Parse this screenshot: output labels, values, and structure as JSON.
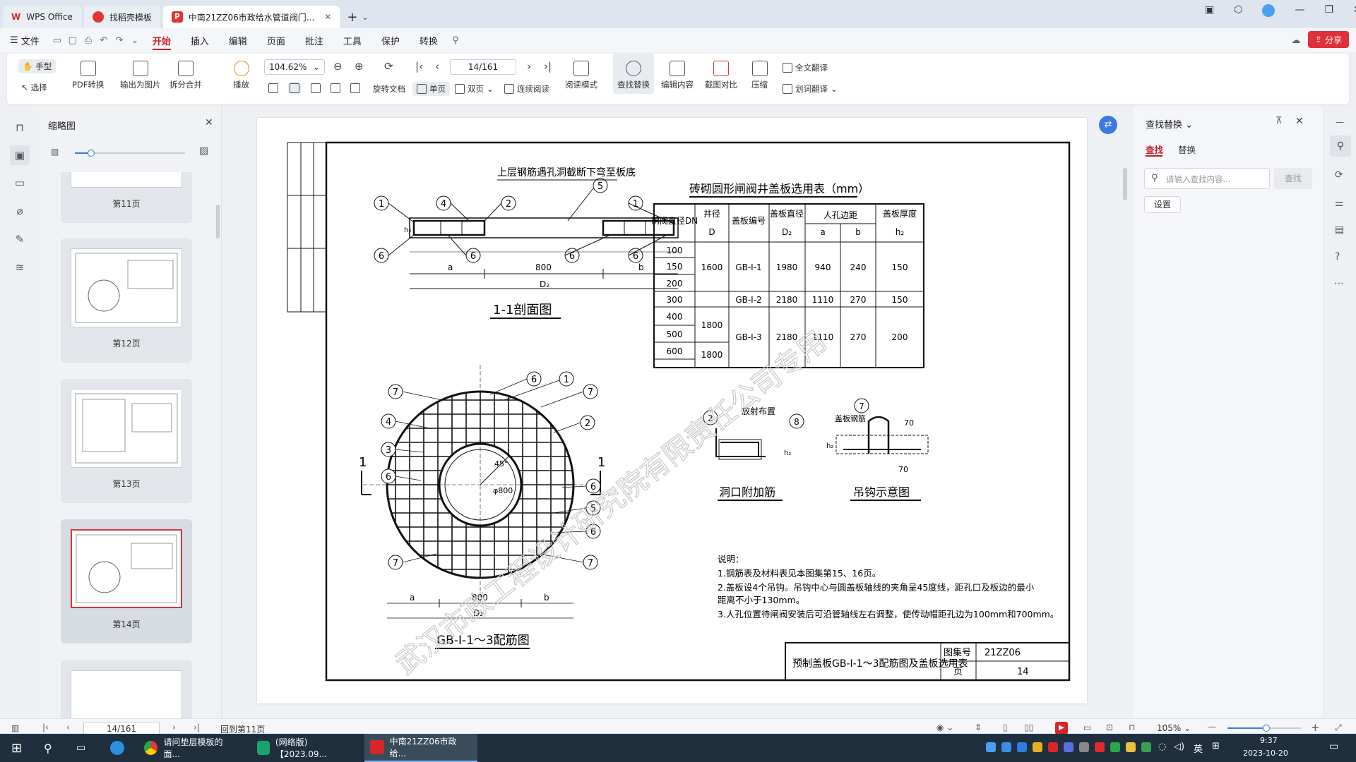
{
  "tabs": [
    {
      "label": "WPS Office"
    },
    {
      "label": "找稻壳模板"
    },
    {
      "label": "中南21ZZ06市政给水管道阀门..."
    }
  ],
  "menu": [
    "文件",
    "开始",
    "插入",
    "编辑",
    "页面",
    "批注",
    "工具",
    "保护",
    "转换"
  ],
  "share_label": "分享",
  "ribbon": {
    "hand": "手型",
    "select": "选择",
    "pdf_convert": "PDF转换",
    "export_image": "输出为图片",
    "split_merge": "拆分合并",
    "play": "播放",
    "zoom": "104.62%",
    "rotate": "旋转文档",
    "single": "单页",
    "double": "双页",
    "continuous": "连续阅读",
    "read_mode": "阅读模式",
    "page": "14/161",
    "find_replace": "查找替换",
    "edit_content": "编辑内容",
    "screenshot_compare": "截图对比",
    "compress": "压缩",
    "full_translate": "全文翻译",
    "word_translate": "划词翻译"
  },
  "thumbs": {
    "title": "缩略图",
    "pages": [
      "第11页",
      "第12页",
      "第13页",
      "第14页"
    ]
  },
  "find": {
    "title": "查找替换",
    "tab_find": "查找",
    "tab_replace": "替换",
    "placeholder": "请输入查找内容...",
    "find_btn": "查找",
    "settings": "设置"
  },
  "status": {
    "page": "14/161",
    "back": "回到第11页",
    "zoom": "105%"
  },
  "taskbar": {
    "t1": "请问垫层模板的面...",
    "t2": "(网络版)【2023.09...",
    "t3": "中南21ZZ06市政给...",
    "ime": "英",
    "time": "9:37",
    "date": "2023-10-20"
  },
  "drawing": {
    "watermark": "武汉市政工程设计研究院有限责任公司专用",
    "note_top": "上层钢筋遇孔洞截断下弯至板底",
    "section_title": "1-1剖面图",
    "dim_a": "a",
    "dim_800": "800",
    "dim_b": "b",
    "dim_d2": "D₂",
    "h2": "h₂",
    "table_title": "砖砌圆形闸阀井盖板选用表（mm）",
    "table_headers": [
      "闸阀直径DN",
      "井径",
      "盖板编号",
      "盖板直径",
      "人孔边距",
      "盖板厚度"
    ],
    "table_sub": [
      "D",
      "D₂",
      "a",
      "b",
      "h₂"
    ],
    "dn": [
      "100",
      "150",
      "200",
      "300",
      "400",
      "500",
      "600"
    ],
    "well": [
      "1600",
      "1800",
      "1800"
    ],
    "cover": [
      "GB-Ⅰ-1",
      "GB-Ⅰ-2",
      "GB-Ⅰ-3"
    ],
    "cover_d": [
      "1980",
      "2180",
      "2180"
    ],
    "a_vals": [
      "940",
      "1110",
      "1110"
    ],
    "b_vals": [
      "240",
      "270",
      "270"
    ],
    "thick": [
      "150",
      "150",
      "200"
    ],
    "plan_title": "GB-Ⅰ-1～3配筋图",
    "angle": "45°",
    "hole": "φ800",
    "sec_label": "1",
    "radial": "放射布置",
    "hole_rebar": "洞口附加筋",
    "hook_rebar": "盖板钢筋",
    "hook_title": "吊钩示意图",
    "dim70": "70",
    "notes_title": "说明：",
    "notes": [
      "1.钢筋表及材料表见本图集第15、16页。",
      "2.盖板设4个吊钩。吊钩中心与圆盖板轴线的夹角呈45度线，距孔口及板边的最小",
      "   距离不小于130mm。",
      "3.人孔位置待闸阀安装后可沿管轴线左右调整，使传动帽距孔边为100mm和700mm。"
    ],
    "title_block": "预制盖板GB-Ⅰ-1～3配筋图及盖板选用表",
    "atlas_label": "图集号",
    "atlas_no": "21ZZ06",
    "page_label": "页",
    "page_no": "14",
    "circle_nums": [
      "1",
      "2",
      "3",
      "4",
      "5",
      "6",
      "7",
      "8"
    ]
  },
  "colors": {
    "accent": "#c4222a",
    "share": "#e0313a",
    "taskbar": "#1f2f3e"
  }
}
